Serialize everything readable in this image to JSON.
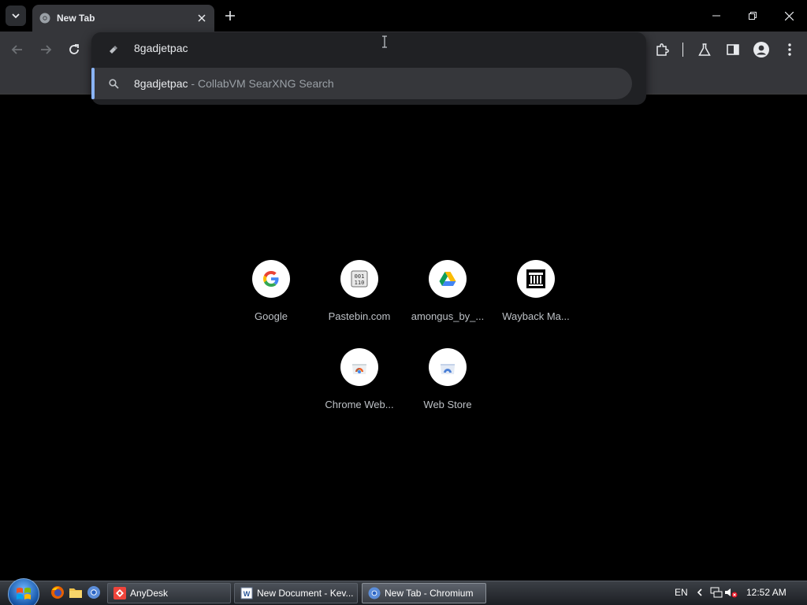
{
  "window": {
    "tab_title": "New Tab"
  },
  "omnibox": {
    "input_value": "8gadjetpac",
    "suggestion_query": "8gadjetpac",
    "suggestion_separator": " - ",
    "suggestion_engine": "CollabVM SearXNG Search"
  },
  "shortcuts": [
    {
      "label": "Google",
      "icon": "google-g-icon"
    },
    {
      "label": "Pastebin.com",
      "icon": "pastebin-icon"
    },
    {
      "label": "amongus_by_...",
      "icon": "google-drive-icon"
    },
    {
      "label": "Wayback Ma...",
      "icon": "archive-building-icon"
    },
    {
      "label": "Chrome Web...",
      "icon": "chrome-web-store-icon"
    },
    {
      "label": "Web Store",
      "icon": "web-store-icon"
    }
  ],
  "taskbar": {
    "items": [
      {
        "label": "AnyDesk",
        "icon": "anydesk-icon"
      },
      {
        "label": "New Document - Kev...",
        "icon": "word-document-icon"
      },
      {
        "label": "New Tab - Chromium",
        "icon": "chromium-icon"
      }
    ],
    "language": "EN",
    "clock": "12:52 AM"
  },
  "colors": {
    "accent": "#8ab4f8",
    "toolbar_bg": "#35363a",
    "popup_bg": "#202124",
    "page_bg": "#000000"
  }
}
